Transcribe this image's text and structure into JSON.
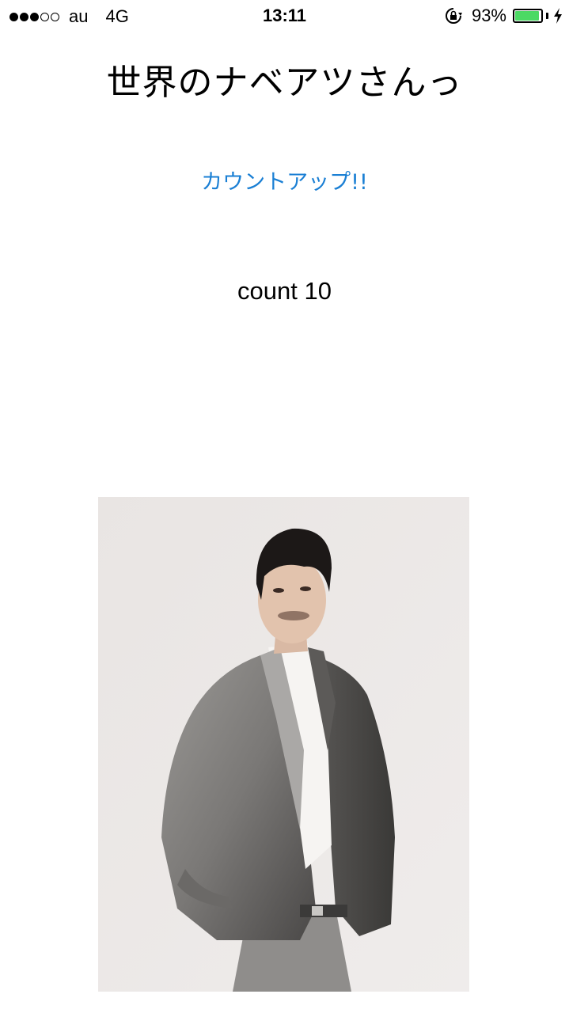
{
  "status_bar": {
    "signal_filled": 3,
    "signal_total": 5,
    "carrier": "au",
    "network": "4G",
    "time": "13:11",
    "battery_percent": "93%",
    "battery_level": 0.93,
    "battery_color": "#4cd964"
  },
  "app": {
    "title": "世界のナベアツさんっ",
    "countup_button_label": "カウントアップ!!",
    "count_text": "count 10",
    "link_color": "#1a7fd4"
  },
  "icons": {
    "orientation_lock": "orientation-lock-icon",
    "charging": "charging-bolt-icon"
  }
}
